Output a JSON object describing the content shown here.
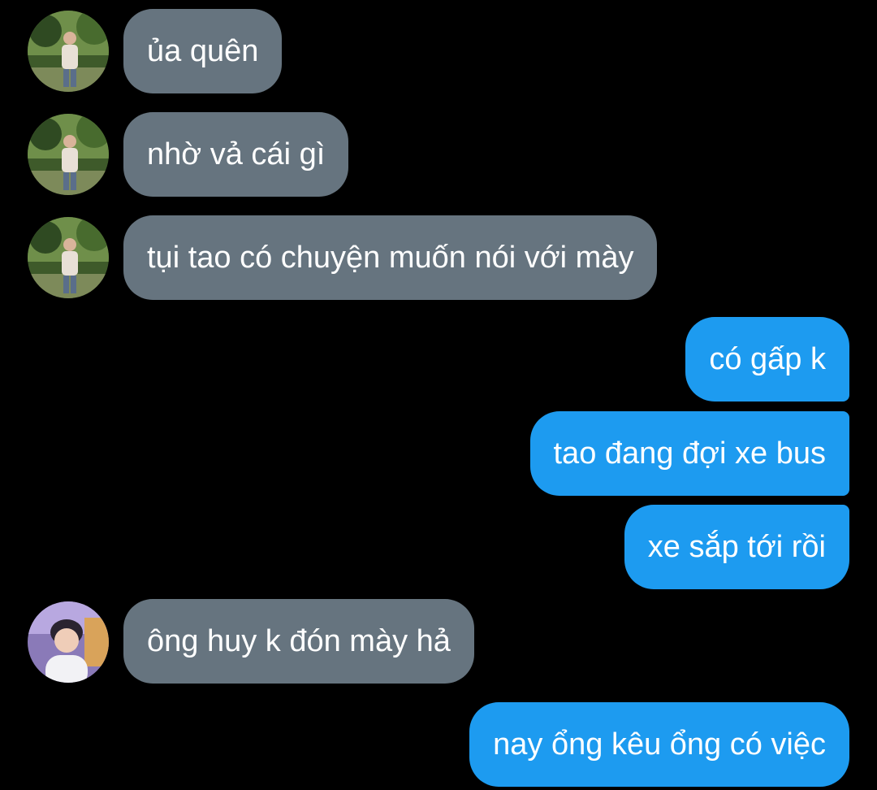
{
  "conversation": {
    "messages": [
      {
        "sender": "contact_a",
        "direction": "incoming",
        "text": "ủa quên"
      },
      {
        "sender": "contact_a",
        "direction": "incoming",
        "text": "nhờ vả cái gì"
      },
      {
        "sender": "contact_a",
        "direction": "incoming",
        "text": "tụi tao có chuyện muốn nói với mày"
      },
      {
        "sender": "me",
        "direction": "outgoing",
        "text": "có gấp k"
      },
      {
        "sender": "me",
        "direction": "outgoing",
        "text": "tao đang đợi xe bus"
      },
      {
        "sender": "me",
        "direction": "outgoing",
        "text": "xe sắp tới rồi"
      },
      {
        "sender": "contact_b",
        "direction": "incoming",
        "text": "ông huy k đón mày hả"
      },
      {
        "sender": "me",
        "direction": "outgoing",
        "text": "nay ổng kêu ổng có việc"
      }
    ]
  },
  "colors": {
    "background": "#000000",
    "incoming_bubble": "#66747f",
    "outgoing_bubble": "#1d9bf0",
    "text": "#ffffff"
  },
  "icons": {
    "contact_a_avatar": "avatar-photo-person-in-park",
    "contact_b_avatar": "avatar-photo-smiling-person"
  }
}
